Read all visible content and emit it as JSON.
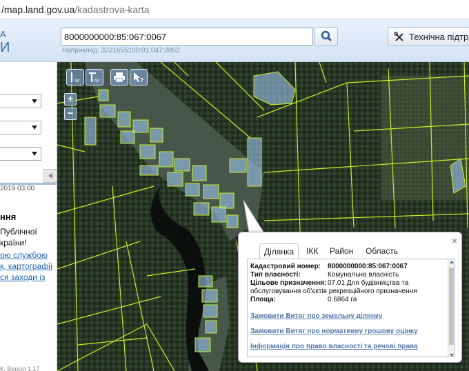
{
  "browser": {
    "url_host": "/map.land.gov.ua",
    "url_path": "/kadastrova-karta"
  },
  "header": {
    "logo_line1": "А",
    "logo_line2": "И",
    "search_value": "8000000000:85:067:0067",
    "search_hint": "Наприклад: 3221655100:01:047:0052",
    "support_label": "Технічна підтримка"
  },
  "sidebar": {
    "date_text": "2019 03:00",
    "title": "ння",
    "text_line1": "Публічної",
    "text_line2": "країни!",
    "link1": "ою службою",
    "link2": "к, картографії",
    "link3": "ся заходи із",
    "footer": "К. Версія 1.17"
  },
  "map": {
    "tools": [
      "ruler-m-icon",
      "ruler-area-icon",
      "print-icon",
      "info-cursor-icon"
    ],
    "zoom_in": "+",
    "zoom_out": "−"
  },
  "popup": {
    "tabs": [
      "Ділянка",
      "ІКК",
      "Район",
      "Область"
    ],
    "active_tab": "Ділянка",
    "cadastral_label": "Кадастровий номер:",
    "cadastral_value": "8000000000:85:067:0067",
    "ownership_label": "Тип власності:",
    "ownership_value": "Комунальна власність",
    "purpose_label": "Цільове призначення:",
    "purpose_value_1": "07.01 Для будівництва та",
    "purpose_value_2": "обслуговування об'єктів рекреаційного призначення",
    "area_label": "Площа:",
    "area_value": "0.6864 га",
    "link_extract": "Замовити Витяг про земельну ділянку",
    "link_valuation": "Замовити Витяг про нормативну грошову оцінку",
    "link_rights": "Інформація про право власності та речові права",
    "close_symbol": "×"
  },
  "colors": {
    "parcel_line": "#c8f02a",
    "parcel_fill_blue": "#9cc4ec",
    "link_blue": "#2266bb"
  }
}
